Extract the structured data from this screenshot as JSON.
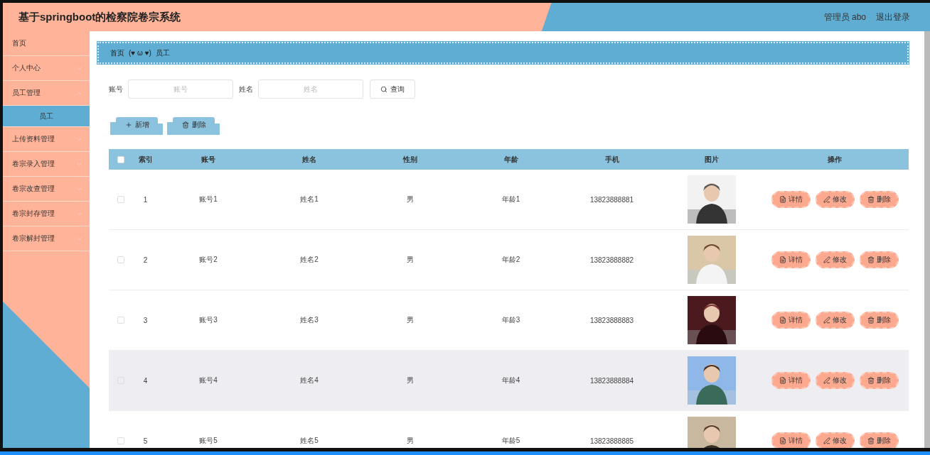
{
  "header": {
    "title": "基于springboot的检察院卷宗系统",
    "user": "管理员 abo",
    "logout": "退出登录"
  },
  "sidebar": {
    "items": [
      {
        "label": "首页",
        "expandable": false,
        "selected": false
      },
      {
        "label": "个人中心",
        "expandable": true,
        "expanded": false,
        "selected": false
      },
      {
        "label": "员工管理",
        "expandable": true,
        "expanded": true,
        "selected": false,
        "children": [
          {
            "label": "员工",
            "selected": true
          }
        ]
      },
      {
        "label": "上传资料管理",
        "expandable": true,
        "expanded": false,
        "selected": false
      },
      {
        "label": "卷宗录入管理",
        "expandable": true,
        "expanded": false,
        "selected": false
      },
      {
        "label": "卷宗改查管理",
        "expandable": true,
        "expanded": false,
        "selected": false
      },
      {
        "label": "卷宗封存管理",
        "expandable": true,
        "expanded": false,
        "selected": false
      },
      {
        "label": "卷宗解封管理",
        "expandable": true,
        "expanded": false,
        "selected": false
      }
    ]
  },
  "breadcrumb": {
    "home": "首页",
    "separator": "(♥ ω ♥)",
    "current": "员工"
  },
  "search": {
    "fields": [
      {
        "label": "账号",
        "placeholder": "账号"
      },
      {
        "label": "姓名",
        "placeholder": "姓名"
      }
    ],
    "button": "查询"
  },
  "toolbar": [
    {
      "kind": "add",
      "label": "新增"
    },
    {
      "kind": "delete",
      "label": "删除"
    }
  ],
  "table": {
    "select_all": false,
    "columns": [
      "索引",
      "账号",
      "姓名",
      "性别",
      "年龄",
      "手机",
      "图片",
      "操作"
    ],
    "rows": [
      {
        "index": "1",
        "account": "账号1",
        "name": "姓名1",
        "gender": "男",
        "age": "年龄1",
        "phone": "13823888881",
        "selected": false,
        "highlighted": false,
        "actions": [
          {
            "kind": "detail",
            "label": "详情"
          },
          {
            "kind": "edit",
            "label": "修改"
          },
          {
            "kind": "delete",
            "label": "删除"
          }
        ]
      },
      {
        "index": "2",
        "account": "账号2",
        "name": "姓名2",
        "gender": "男",
        "age": "年龄2",
        "phone": "13823888882",
        "selected": false,
        "highlighted": false,
        "actions": [
          {
            "kind": "detail",
            "label": "详情"
          },
          {
            "kind": "edit",
            "label": "修改"
          },
          {
            "kind": "delete",
            "label": "删除"
          }
        ]
      },
      {
        "index": "3",
        "account": "账号3",
        "name": "姓名3",
        "gender": "男",
        "age": "年龄3",
        "phone": "13823888883",
        "selected": false,
        "highlighted": false,
        "actions": [
          {
            "kind": "detail",
            "label": "详情"
          },
          {
            "kind": "edit",
            "label": "修改"
          },
          {
            "kind": "delete",
            "label": "删除"
          }
        ]
      },
      {
        "index": "4",
        "account": "账号4",
        "name": "姓名4",
        "gender": "男",
        "age": "年龄4",
        "phone": "13823888884",
        "selected": false,
        "highlighted": true,
        "actions": [
          {
            "kind": "detail",
            "label": "详情"
          },
          {
            "kind": "edit",
            "label": "修改"
          },
          {
            "kind": "delete",
            "label": "删除"
          }
        ]
      },
      {
        "index": "5",
        "account": "账号5",
        "name": "姓名5",
        "gender": "男",
        "age": "年龄5",
        "phone": "13823888885",
        "selected": false,
        "highlighted": false,
        "actions": [
          {
            "kind": "detail",
            "label": "详情"
          },
          {
            "kind": "edit",
            "label": "修改"
          },
          {
            "kind": "delete",
            "label": "删除"
          }
        ]
      }
    ]
  }
}
